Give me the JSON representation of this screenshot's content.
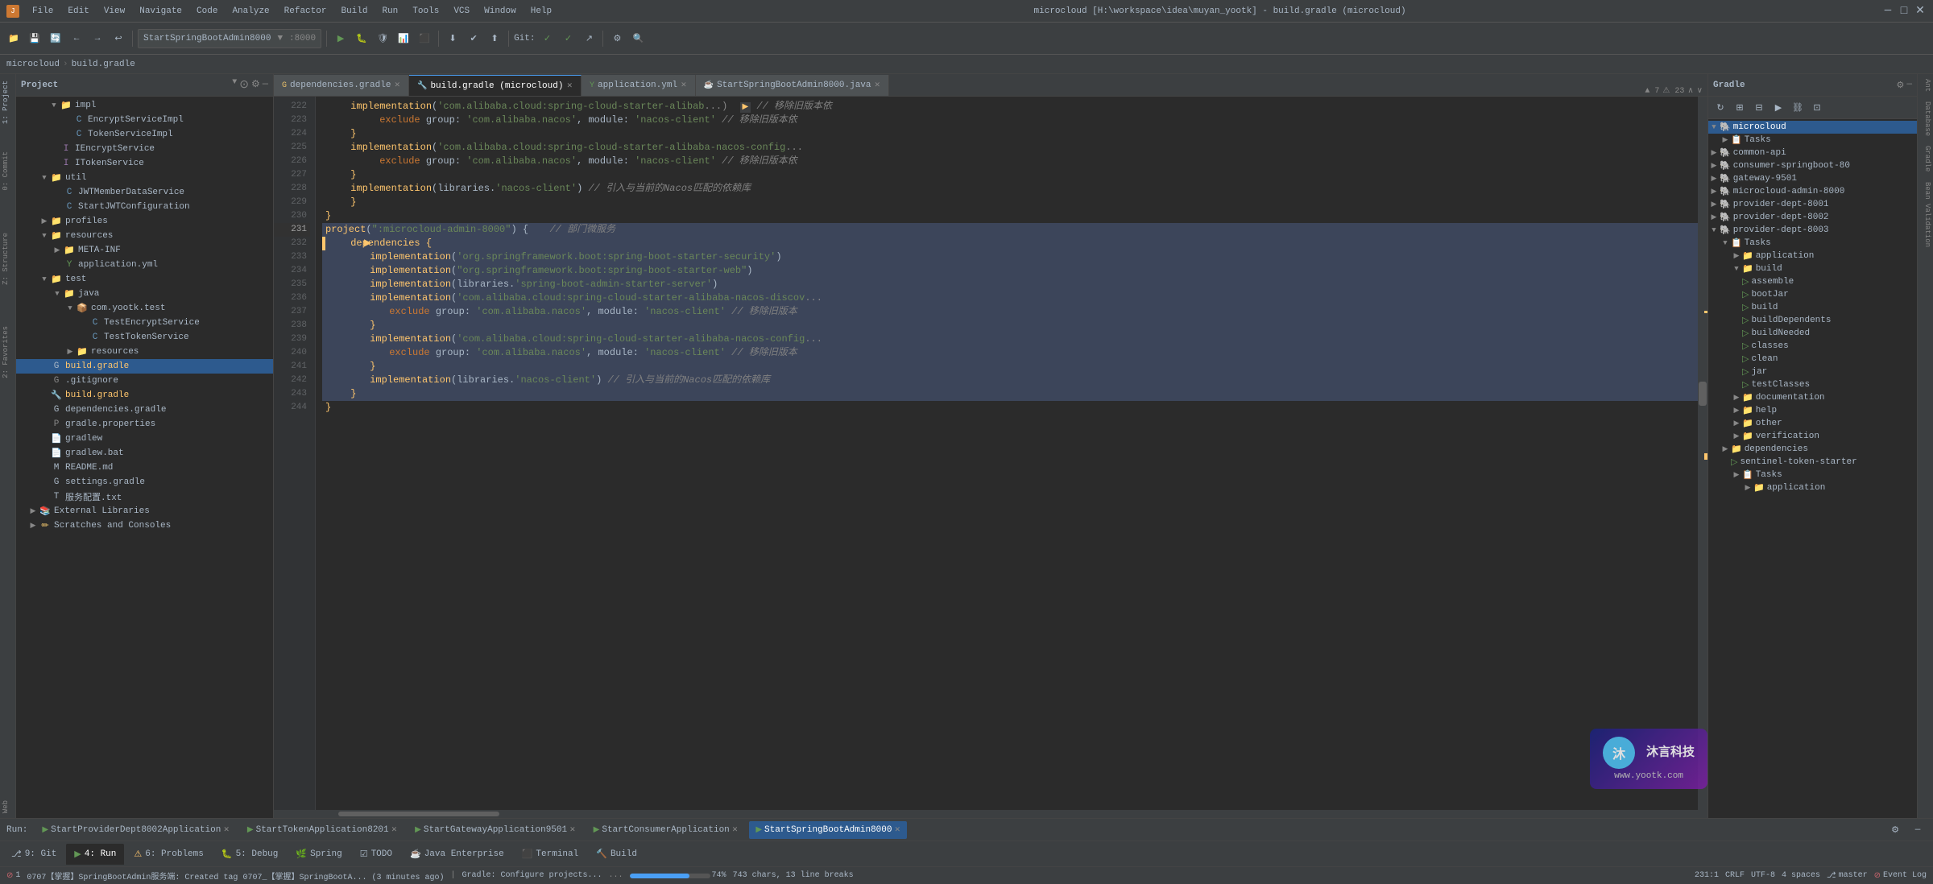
{
  "app": {
    "title": "microcloud [H:\\workspace\\idea\\muyan_yootk] - build.gradle (microcloud)",
    "icon": "🔷"
  },
  "menu": {
    "items": [
      "File",
      "Edit",
      "View",
      "Navigate",
      "Code",
      "Analyze",
      "Refactor",
      "Build",
      "Run",
      "Tools",
      "VCS",
      "Window",
      "Help"
    ]
  },
  "toolbar": {
    "dropdown_label": "StartSpringBootAdmin8000",
    "git_label": "Git:"
  },
  "breadcrumb": {
    "items": [
      "microcloud",
      "build.gradle"
    ]
  },
  "tabs": [
    {
      "label": "dependencies.gradle",
      "active": false,
      "icon": "📄"
    },
    {
      "label": "build.gradle (microcloud)",
      "active": true,
      "icon": "🔧"
    },
    {
      "label": "application.yml",
      "active": false,
      "icon": "📄"
    },
    {
      "label": "StartSpringBootAdmin8000.java",
      "active": false,
      "icon": "☕"
    },
    {
      "label": "Gradle",
      "active": false,
      "panel": true
    }
  ],
  "editor": {
    "line_start": 222,
    "lines": [
      {
        "num": 222,
        "content": "    implementation('com.alibaba.cloud:spring-cloud-starter-alibab",
        "comment": "// 移除旧版本依"
      },
      {
        "num": 223,
        "content": "        exclude group: 'com.alibaba.nacos', module: 'nacos-client' // 移除旧版本依"
      },
      {
        "num": 224,
        "content": "    }"
      },
      {
        "num": 225,
        "content": "    implementation('com.alibaba.cloud:spring-cloud-starter-alibaba-nacos-config",
        "comment": ""
      },
      {
        "num": 226,
        "content": "        exclude group: 'com.alibaba.nacos', module: 'nacos-client' // 移除旧版本依"
      },
      {
        "num": 227,
        "content": "    }"
      },
      {
        "num": 228,
        "content": "    implementation(libraries.'nacos-client') // 引入与当前的Nacos匹配的依赖库"
      },
      {
        "num": 229,
        "content": "    }"
      },
      {
        "num": 230,
        "content": "}"
      },
      {
        "num": 231,
        "content": "project(\":microcloud-admin-8000\") {    // 部门微服务",
        "highlighted": true
      },
      {
        "num": 232,
        "content": "    dependencies {",
        "highlighted": true,
        "has_arrow": true
      },
      {
        "num": 233,
        "content": "        implementation('org.springframework.boot:spring-boot-starter-security')",
        "highlighted": true
      },
      {
        "num": 234,
        "content": "        implementation(\"org.springframework.boot:spring-boot-starter-web\")",
        "highlighted": true
      },
      {
        "num": 235,
        "content": "        implementation(libraries.'spring-boot-admin-starter-server')",
        "highlighted": true
      },
      {
        "num": 236,
        "content": "        implementation('com.alibaba.cloud:spring-cloud-starter-alibaba-nacos-discov",
        "highlighted": true
      },
      {
        "num": 237,
        "content": "            exclude group: 'com.alibaba.nacos', module: 'nacos-client' // 移除旧版本",
        "highlighted": true
      },
      {
        "num": 238,
        "content": "        }",
        "highlighted": true
      },
      {
        "num": 239,
        "content": "        implementation('com.alibaba.cloud:spring-cloud-starter-alibaba-nacos-config",
        "highlighted": true
      },
      {
        "num": 240,
        "content": "            exclude group: 'com.alibaba.nacos', module: 'nacos-client' // 移除旧版本",
        "highlighted": true
      },
      {
        "num": 241,
        "content": "        }",
        "highlighted": true
      },
      {
        "num": 242,
        "content": "        implementation(libraries.'nacos-client') // 引入与当前的Nacos匹配的依赖库",
        "highlighted": true
      },
      {
        "num": 243,
        "content": "    }",
        "highlighted": true
      },
      {
        "num": 244,
        "content": "}",
        "highlighted": false
      }
    ]
  },
  "project_tree": {
    "title": "Project",
    "items": [
      {
        "indent": 1,
        "type": "folder",
        "label": "impl",
        "expanded": true
      },
      {
        "indent": 2,
        "type": "java",
        "label": "EncryptServiceImpl"
      },
      {
        "indent": 2,
        "type": "java",
        "label": "TokenServiceImpl"
      },
      {
        "indent": 1,
        "type": "interface",
        "label": "IEncryptService"
      },
      {
        "indent": 1,
        "type": "interface",
        "label": "ITokenService"
      },
      {
        "indent": 0,
        "type": "folder",
        "label": "util",
        "expanded": true
      },
      {
        "indent": 1,
        "type": "java",
        "label": "JWTMemberDataService"
      },
      {
        "indent": 1,
        "type": "java",
        "label": "StartJWTConfiguration"
      },
      {
        "indent": 0,
        "type": "folder",
        "label": "profiles",
        "expanded": false
      },
      {
        "indent": 0,
        "type": "folder",
        "label": "resources",
        "expanded": true
      },
      {
        "indent": 1,
        "type": "folder",
        "label": "META-INF",
        "expanded": false
      },
      {
        "indent": 1,
        "type": "yml",
        "label": "application.yml"
      },
      {
        "indent": 0,
        "type": "folder",
        "label": "test",
        "expanded": true
      },
      {
        "indent": 1,
        "type": "folder",
        "label": "java",
        "expanded": true
      },
      {
        "indent": 2,
        "type": "package",
        "label": "com.yootk.test",
        "expanded": true
      },
      {
        "indent": 3,
        "type": "java",
        "label": "TestEncryptService"
      },
      {
        "indent": 3,
        "type": "java",
        "label": "TestTokenService"
      },
      {
        "indent": 2,
        "type": "folder",
        "label": "resources",
        "expanded": false
      },
      {
        "indent": 0,
        "type": "gradle",
        "label": "build.gradle",
        "selected": true
      },
      {
        "indent": 0,
        "type": "git",
        "label": ".gitignore"
      },
      {
        "indent": 0,
        "type": "gradle-selected",
        "label": "build.gradle"
      },
      {
        "indent": 0,
        "type": "gradle",
        "label": "dependencies.gradle"
      },
      {
        "indent": 0,
        "type": "properties",
        "label": "gradle.properties"
      },
      {
        "indent": 0,
        "type": "file",
        "label": "gradlew"
      },
      {
        "indent": 0,
        "type": "file",
        "label": "gradlew.bat"
      },
      {
        "indent": 0,
        "type": "md",
        "label": "README.md"
      },
      {
        "indent": 0,
        "type": "gradle",
        "label": "settings.gradle"
      },
      {
        "indent": 0,
        "type": "file",
        "label": "服务配置.txt"
      },
      {
        "indent": 0,
        "type": "folder",
        "label": "External Libraries",
        "expanded": false
      },
      {
        "indent": 0,
        "type": "folder",
        "label": "Scratches and Consoles",
        "expanded": false
      }
    ]
  },
  "gradle_panel": {
    "title": "Gradle",
    "tree": [
      {
        "indent": 0,
        "type": "gradle-root",
        "label": "microcloud",
        "expanded": true,
        "selected": true
      },
      {
        "indent": 1,
        "type": "folder",
        "label": "Tasks",
        "expanded": false
      },
      {
        "indent": 0,
        "type": "gradle-module",
        "label": "common-api",
        "expanded": false
      },
      {
        "indent": 0,
        "type": "gradle-module",
        "label": "consumer-springboot-80",
        "expanded": false
      },
      {
        "indent": 0,
        "type": "gradle-module",
        "label": "gateway-9501",
        "expanded": false
      },
      {
        "indent": 0,
        "type": "gradle-module",
        "label": "microcloud-admin-8000",
        "expanded": false
      },
      {
        "indent": 0,
        "type": "gradle-module",
        "label": "provider-dept-8001",
        "expanded": false
      },
      {
        "indent": 0,
        "type": "gradle-module",
        "label": "provider-dept-8002",
        "expanded": false
      },
      {
        "indent": 0,
        "type": "gradle-module",
        "label": "provider-dept-8003",
        "expanded": true
      },
      {
        "indent": 1,
        "type": "folder",
        "label": "Tasks",
        "expanded": true
      },
      {
        "indent": 2,
        "type": "folder",
        "label": "application",
        "expanded": false
      },
      {
        "indent": 2,
        "type": "folder",
        "label": "build",
        "expanded": true
      },
      {
        "indent": 3,
        "type": "task",
        "label": "assemble"
      },
      {
        "indent": 3,
        "type": "task",
        "label": "bootJar"
      },
      {
        "indent": 3,
        "type": "task",
        "label": "build"
      },
      {
        "indent": 3,
        "type": "task",
        "label": "buildDependents"
      },
      {
        "indent": 3,
        "type": "task",
        "label": "buildNeeded"
      },
      {
        "indent": 3,
        "type": "task",
        "label": "classes"
      },
      {
        "indent": 3,
        "type": "task",
        "label": "clean"
      },
      {
        "indent": 3,
        "type": "task",
        "label": "jar"
      },
      {
        "indent": 3,
        "type": "task",
        "label": "testClasses"
      },
      {
        "indent": 2,
        "type": "folder",
        "label": "documentation",
        "expanded": false
      },
      {
        "indent": 2,
        "type": "folder",
        "label": "help",
        "expanded": false
      },
      {
        "indent": 2,
        "type": "folder",
        "label": "other",
        "expanded": false
      },
      {
        "indent": 2,
        "type": "folder",
        "label": "verification",
        "expanded": false
      },
      {
        "indent": 1,
        "type": "folder",
        "label": "dependencies",
        "expanded": false
      },
      {
        "indent": 2,
        "type": "task",
        "label": "sentinel-token-starter"
      },
      {
        "indent": 2,
        "type": "folder",
        "label": "Tasks",
        "expanded": false
      },
      {
        "indent": 3,
        "type": "folder",
        "label": "application",
        "expanded": false
      }
    ]
  },
  "run_bar": {
    "items": [
      {
        "label": "Run:",
        "type": "label"
      },
      {
        "label": "StartProviderDept8002Application",
        "type": "tab",
        "closeable": true
      },
      {
        "label": "StartTokenApplication8201",
        "type": "tab",
        "closeable": true
      },
      {
        "label": "StartGatewayApplication9501",
        "type": "tab",
        "closeable": true
      },
      {
        "label": "StartConsumerApplication",
        "type": "tab",
        "closeable": true
      },
      {
        "label": "StartSpringBootAdmin8000",
        "type": "tab",
        "closeable": true,
        "active": true
      }
    ]
  },
  "bottom_tabs": [
    {
      "icon": "⎇",
      "label": "9: Git",
      "num": ""
    },
    {
      "icon": "▶",
      "label": "4: Run",
      "num": "",
      "active": true
    },
    {
      "icon": "⚠",
      "label": "6: Problems",
      "num": ""
    },
    {
      "icon": "🐛",
      "label": "5: Debug",
      "num": ""
    },
    {
      "icon": "🌿",
      "label": "Spring",
      "num": ""
    },
    {
      "icon": "☑",
      "label": "TODO",
      "num": ""
    },
    {
      "icon": "☕",
      "label": "Java Enterprise",
      "num": ""
    },
    {
      "icon": "⬛",
      "label": "Terminal",
      "num": ""
    },
    {
      "icon": "🔨",
      "label": "Build",
      "num": ""
    }
  ],
  "status_bar": {
    "git_status": "0707【掌握】SpringBootAdmin服务端: Created tag 0707_【掌握】SpringBootA... (3 minutes ago)",
    "gradle_status": "Gradle: Configure projects...",
    "position": "231:1",
    "line_sep": "CRLF",
    "encoding": "UTF-8",
    "indent": "4 spaces",
    "branch": "master",
    "progress": "74%"
  },
  "watermark": {
    "company": "沐言科技",
    "url": "www.yootk.com"
  }
}
